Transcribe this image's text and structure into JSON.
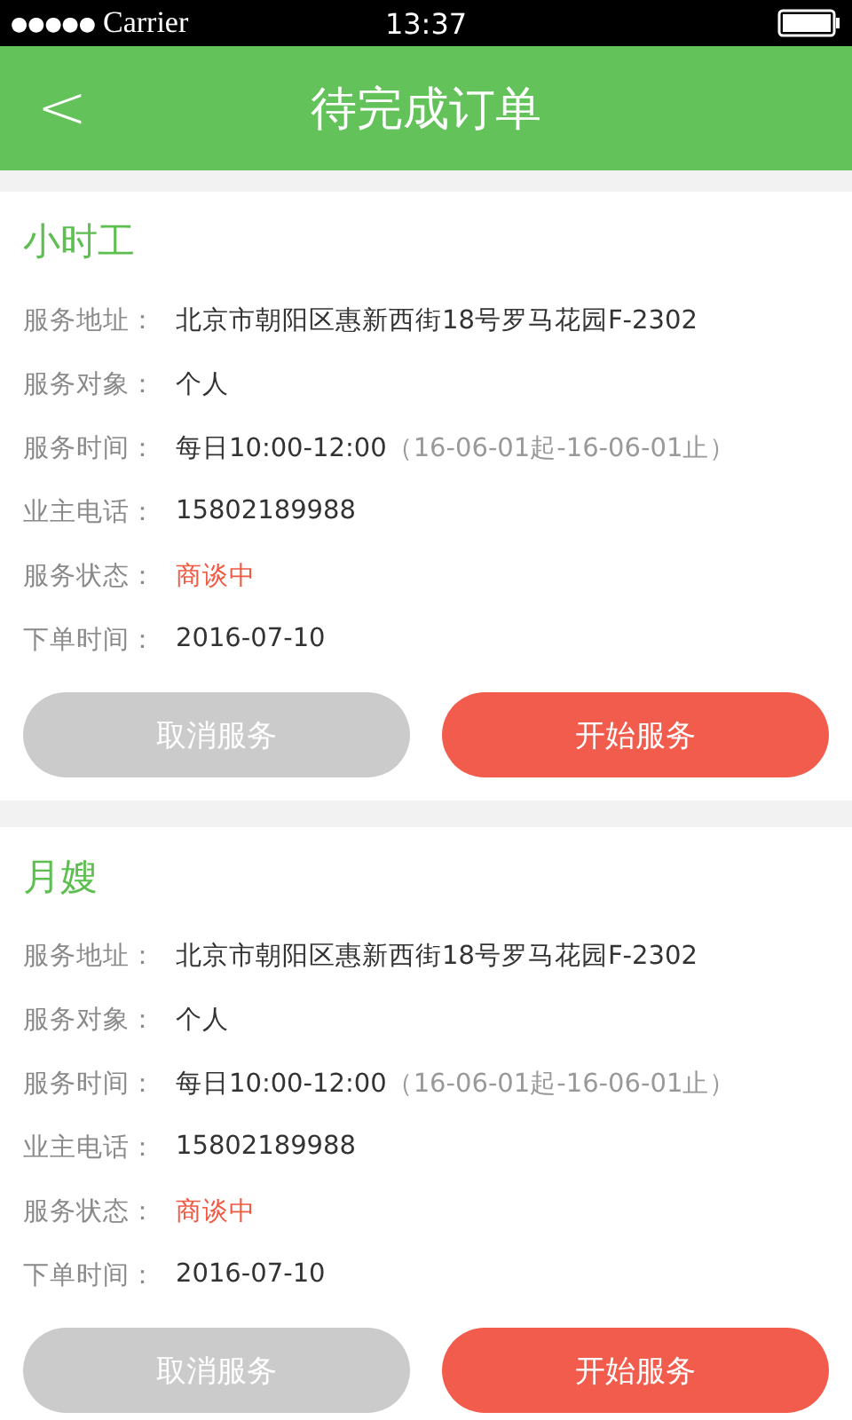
{
  "status_bar": {
    "signal": "●●●●●",
    "carrier": "Carrier",
    "time": "13:37"
  },
  "header": {
    "back": "<",
    "title": "待完成订单"
  },
  "orders": [
    {
      "title": "小时工",
      "fields": [
        {
          "label": "服务地址：",
          "value": "北京市朝阳区惠新西街18号罗马花园F-2302",
          "kind": "text"
        },
        {
          "label": "服务对象：",
          "value": "个人",
          "kind": "text"
        },
        {
          "label": "服务时间：",
          "value": "每日10:00-12:00",
          "note": "（16-06-01起-16-06-01止）",
          "kind": "text"
        },
        {
          "label": "业主电话：",
          "value": "15802189988",
          "kind": "text"
        },
        {
          "label": "服务状态：",
          "value": "商谈中",
          "kind": "status"
        },
        {
          "label": "下单时间：",
          "value": "2016-07-10",
          "kind": "text"
        }
      ],
      "buttons": [
        {
          "label": "取消服务",
          "kind": "cancel"
        },
        {
          "label": "开始服务",
          "kind": "start"
        }
      ]
    },
    {
      "title": "月嫂",
      "fields": [
        {
          "label": "服务地址：",
          "value": "北京市朝阳区惠新西街18号罗马花园F-2302",
          "kind": "text"
        },
        {
          "label": "服务对象：",
          "value": "个人",
          "kind": "text"
        },
        {
          "label": "服务时间：",
          "value": "每日10:00-12:00",
          "note": "（16-06-01起-16-06-01止）",
          "kind": "text"
        },
        {
          "label": "业主电话：",
          "value": "15802189988",
          "kind": "text"
        },
        {
          "label": "服务状态：",
          "value": "商谈中",
          "kind": "status"
        },
        {
          "label": "下单时间：",
          "value": "2016-07-10",
          "kind": "text"
        }
      ],
      "buttons": [
        {
          "label": "取消服务",
          "kind": "cancel"
        },
        {
          "label": "开始服务",
          "kind": "start"
        }
      ]
    }
  ]
}
